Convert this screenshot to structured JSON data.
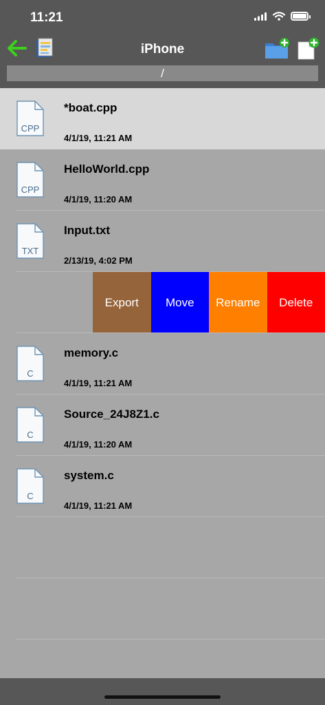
{
  "status": {
    "time": "11:21"
  },
  "nav": {
    "title": "iPhone",
    "path": "/"
  },
  "files": [
    {
      "name": "*boat.cpp",
      "date": "4/1/19, 11:21 AM",
      "type": "CPP",
      "selected": true
    },
    {
      "name": "HelloWorld.cpp",
      "date": "4/1/19, 11:20 AM",
      "type": "CPP"
    },
    {
      "name": "Input.txt",
      "date": "2/13/19, 4:02 PM",
      "type": "TXT"
    },
    {
      "name": "memory.c",
      "date": "4/1/19, 11:21 AM",
      "type": "C"
    },
    {
      "name": "Source_24J8Z1.c",
      "date": "4/1/19, 11:20 AM",
      "type": "C"
    },
    {
      "name": "system.c",
      "date": "4/1/19, 11:21 AM",
      "type": "C"
    }
  ],
  "swipe_actions": [
    {
      "label": "Export",
      "color": "#96643a"
    },
    {
      "label": "Move",
      "color": "#0000ff"
    },
    {
      "label": "Rename",
      "color": "#ff7f00"
    },
    {
      "label": "Delete",
      "color": "#ff0000"
    }
  ],
  "colors": {
    "bar": "#575757",
    "list_bg": "#a7a7a7",
    "selected_row": "#d8d8d8"
  }
}
